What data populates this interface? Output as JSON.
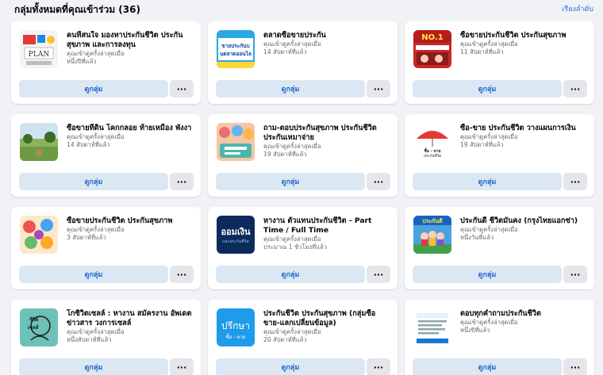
{
  "header": {
    "title": "กลุ่มทั้งหมดที่คุณเข้าร่วม (36)",
    "sort_label": "เรียงลำดับ"
  },
  "groups": [
    {
      "name": "คนที่สนใจ มองหาประกันชีวิต ประกันสุขภาพ และการลงทุน",
      "meta1": "คุณเข้าดูครั้งล่าสุดเมื่อ",
      "meta2": "หนึ่งปีที่แล้ว",
      "thumb_text": "PLAN"
    },
    {
      "name": "ตลาดซื้อขายประกัน",
      "meta1": "คุณเข้าดูครั้งล่าสุดเมื่อ",
      "meta2": "14 สัปดาห์ที่แล้ว",
      "thumb_text": "ขายประกันบนตลาดออนไล"
    },
    {
      "name": "ซื้อขายประกันชีวิต ประกันสุขภาพ",
      "meta1": "คุณเข้าดูครั้งล่าสุดเมื่อ",
      "meta2": "11 สัปดาห์ที่แล้ว",
      "thumb_text": "NO.1"
    },
    {
      "name": "ซื้อขายที่ดิน โคกกลอย ท้ายเหมือง พังงา",
      "meta1": "คุณเข้าดูครั้งล่าสุดเมื่อ",
      "meta2": "14 สัปดาห์ที่แล้ว",
      "thumb_text": ""
    },
    {
      "name": "ถาม-ตอบประกันสุขภาพ ประกันชีวิต ประกันเหมาจ่าย",
      "meta1": "คุณเข้าดูครั้งล่าสุดเมื่อ",
      "meta2": "19 สัปดาห์ที่แล้ว",
      "thumb_text": ""
    },
    {
      "name": "ซื้อ-ขาย ประกันชีวิต วางแผนการเงิน",
      "meta1": "คุณเข้าดูครั้งล่าสุดเมื่อ",
      "meta2": "19 สัปดาห์ที่แล้ว",
      "thumb_text": "ซื้อ - ขาย ประกันชีวิต วางแผนการเงิน"
    },
    {
      "name": "ซื้อขายประกันชีวิต ประกันสุขภาพ",
      "meta1": "คุณเข้าดูครั้งล่าสุดเมื่อ",
      "meta2": "3 สัปดาห์ที่แล้ว",
      "thumb_text": ""
    },
    {
      "name": "หางาน ตัวแทนประกันชีวิต - Part Time / Full Time",
      "meta1": "คุณเข้าดูครั้งล่าสุดเมื่อ",
      "meta2": "ประมาณ 1 ชั่วโมงที่แล้ว",
      "thumb_text": "ออมเงิน และประกันชีวิต"
    },
    {
      "name": "ประกันดี ชีวิตมั่นคง (กรุงไทยแอกซ่า)",
      "meta1": "คุณเข้าดูครั้งล่าสุดเมื่อ",
      "meta2": "หนึ่งวันที่แล้ว",
      "thumb_text": "ประกันดี"
    },
    {
      "name": "โกซิวิตเซลล์ : หางาน สมัครงาน อัพเดตข่าวสาร วงการเซลล์",
      "meta1": "คุณเข้าดูครั้งล่าสุดเมื่อ",
      "meta2": "หนึ่งสัปดาห์ที่แล้ว",
      "thumb_text": "ชีวิตเซลล์"
    },
    {
      "name": "ประกันชีวิต ประกันสุขภาพ (กลุ่มซื้อขาย-แลกเปลี่ยนข้อมูล)",
      "meta1": "คุณเข้าดูครั้งล่าสุดเมื่อ",
      "meta2": "20 สัปดาห์ที่แล้ว",
      "thumb_text": "ปรึกษา"
    },
    {
      "name": "ตอบทุกคำถามประกันชีวิต",
      "meta1": "คุณเข้าดูครั้งล่าสุดเมื่อ",
      "meta2": "หนึ่งปีที่แล้ว",
      "thumb_text": ""
    }
  ],
  "buttons": {
    "view_label": "ดูกลุ่ม",
    "more_label": "···"
  },
  "colors": {
    "page_bg": "#f0f2f5",
    "card_bg": "#ffffff",
    "view_button_bg": "#dbe7f2",
    "view_button_text": "#1b66c9",
    "more_button_bg": "#e4e6eb",
    "link": "#216fdb",
    "meta_text": "#65676b"
  }
}
